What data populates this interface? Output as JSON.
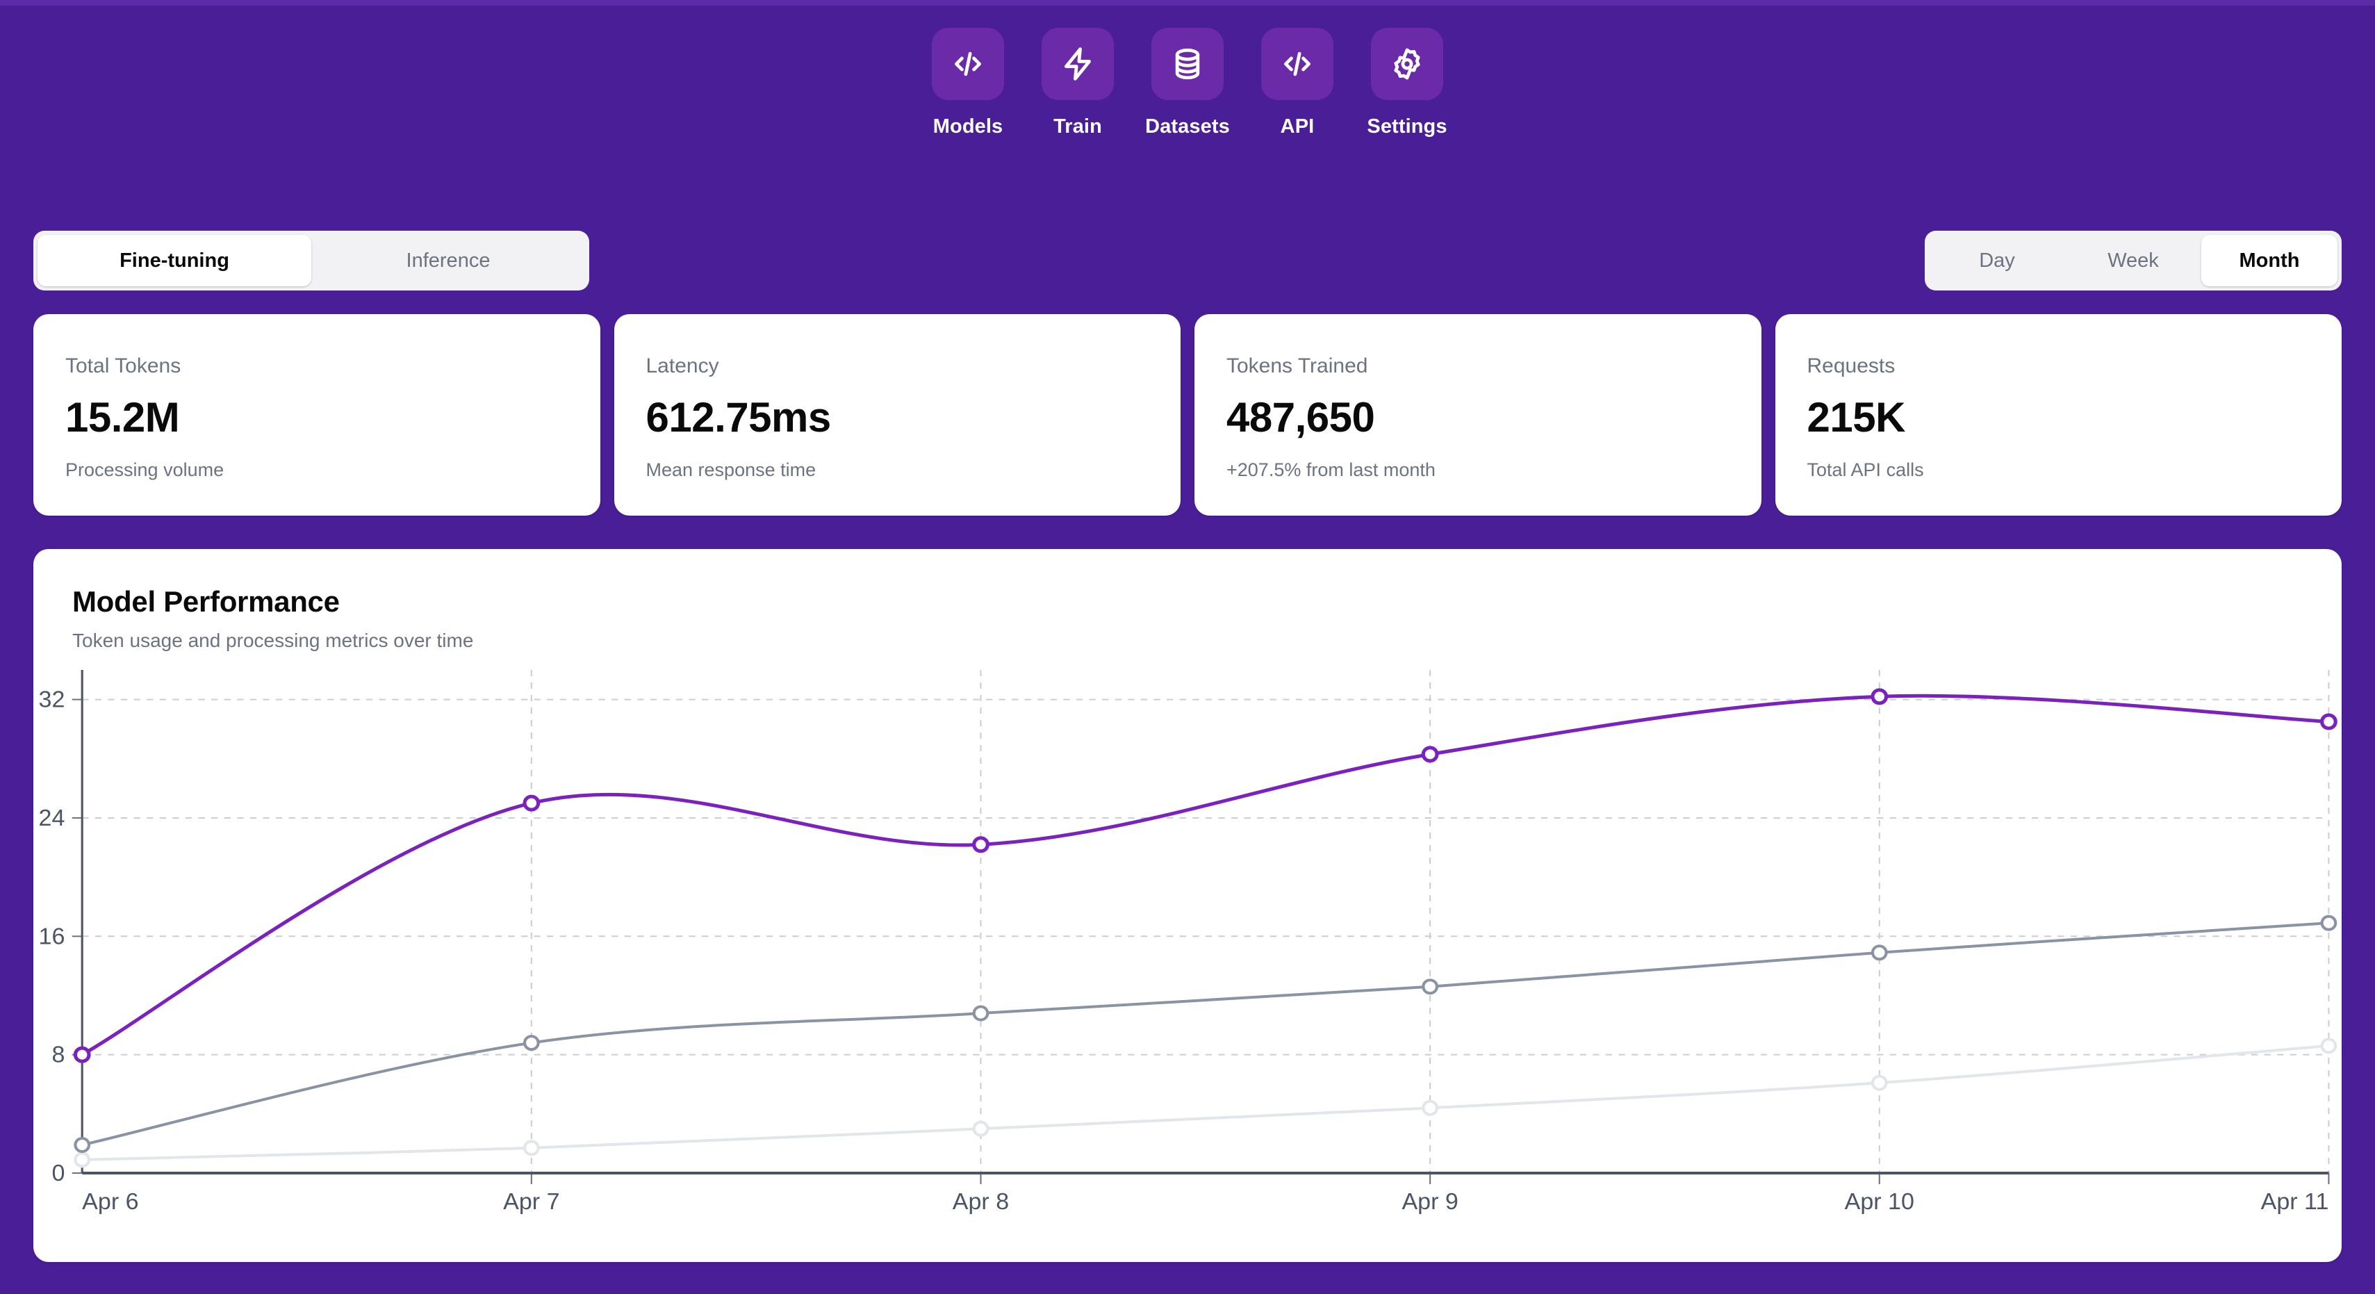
{
  "theme": {
    "background": "#4A1E96",
    "nav_tile": "#6B2BA8",
    "card": "#FFFFFF",
    "accent_purple": "#7B21BD",
    "series_gray": "#8A93A3",
    "series_light": "#E2E5E9",
    "muted_text": "#6B7280"
  },
  "nav": {
    "items": [
      {
        "label": "Models",
        "icon": "code-brackets-icon"
      },
      {
        "label": "Train",
        "icon": "lightning-bolt-icon"
      },
      {
        "label": "Datasets",
        "icon": "database-icon"
      },
      {
        "label": "API",
        "icon": "code-brackets-icon"
      },
      {
        "label": "Settings",
        "icon": "gear-icon"
      }
    ]
  },
  "mode_tabs": {
    "items": [
      {
        "label": "Fine-tuning",
        "active": true
      },
      {
        "label": "Inference",
        "active": false
      }
    ]
  },
  "period_tabs": {
    "items": [
      {
        "label": "Day",
        "active": false
      },
      {
        "label": "Week",
        "active": false
      },
      {
        "label": "Month",
        "active": true
      }
    ]
  },
  "stats": [
    {
      "label": "Total Tokens",
      "value": "15.2M",
      "sub": "Processing volume"
    },
    {
      "label": "Latency",
      "value": "612.75ms",
      "sub": "Mean response time"
    },
    {
      "label": "Tokens Trained",
      "value": "487,650",
      "sub": "+207.5% from last month"
    },
    {
      "label": "Requests",
      "value": "215K",
      "sub": "Total API calls"
    }
  ],
  "chart_card": {
    "title": "Model Performance",
    "subtitle": "Token usage and processing metrics over time"
  },
  "chart_data": {
    "type": "line",
    "title": "Model Performance",
    "subtitle": "Token usage and processing metrics over time",
    "xlabel": "",
    "ylabel": "",
    "categories": [
      "Apr 6",
      "Apr 7",
      "Apr 8",
      "Apr 9",
      "Apr 10",
      "Apr 11"
    ],
    "x_tick_labels": [
      "Apr 6",
      "Apr 7",
      "Apr 8",
      "Apr 9",
      "Apr 10",
      "Apr 11"
    ],
    "y_tick_labels": [
      "0",
      "8",
      "16",
      "24",
      "32"
    ],
    "y_ticks": [
      0,
      8,
      16,
      24,
      32
    ],
    "ylim": [
      0,
      34
    ],
    "grid": true,
    "grid_style": "dashed",
    "legend": "none",
    "curve": "smooth",
    "markers": "open-circle",
    "series": [
      {
        "name": "series-1",
        "color": "#7B21BD",
        "width": 5,
        "values": [
          8.0,
          25.0,
          22.2,
          28.3,
          32.2,
          30.5
        ]
      },
      {
        "name": "series-2",
        "color": "#8A93A3",
        "width": 4,
        "values": [
          1.9,
          8.8,
          10.8,
          12.6,
          14.9,
          16.9
        ]
      },
      {
        "name": "series-3",
        "color": "#E2E5E9",
        "width": 4,
        "values": [
          0.9,
          1.7,
          3.0,
          4.4,
          6.1,
          8.6
        ]
      }
    ]
  }
}
